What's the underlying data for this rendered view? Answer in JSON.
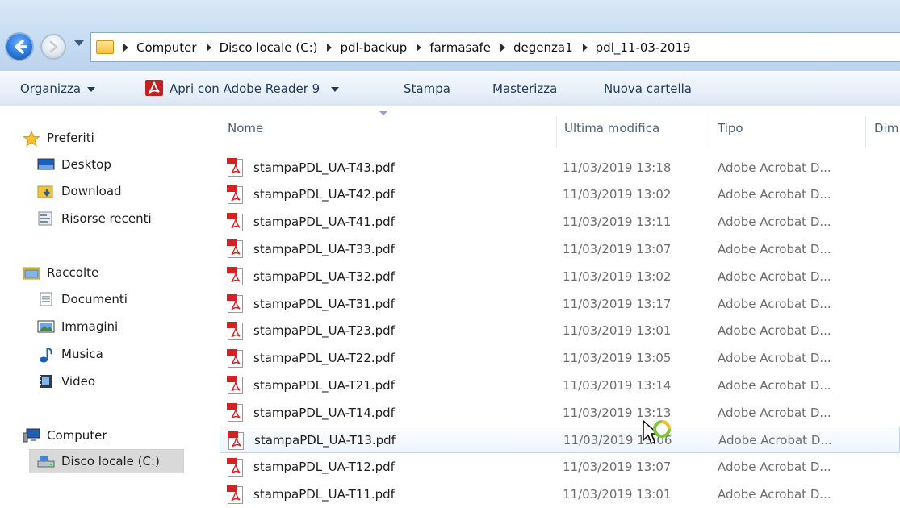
{
  "address": {
    "crumbs": [
      "Computer",
      "Disco locale (C:)",
      "pdl-backup",
      "farmasafe",
      "degenza1",
      "pdl_11-03-2019"
    ]
  },
  "toolbar": {
    "organize": "Organizza",
    "open_with": "Apri con Adobe Reader 9",
    "print": "Stampa",
    "burn": "Masterizza",
    "new_folder": "Nuova cartella"
  },
  "nav": {
    "favorites": "Preferiti",
    "desktop": "Desktop",
    "download": "Download",
    "recent": "Risorse recenti",
    "libraries": "Raccolte",
    "documents": "Documenti",
    "pictures": "Immagini",
    "music": "Musica",
    "video": "Video",
    "computer": "Computer",
    "local_disk": "Disco locale (C:)"
  },
  "columns": {
    "name": "Nome",
    "modified": "Ultima modifica",
    "type": "Tipo",
    "size": "Dim"
  },
  "files": [
    {
      "name": "stampaPDL_UA-T43.pdf",
      "modified": "11/03/2019 13:18",
      "type": "Adobe Acrobat D..."
    },
    {
      "name": "stampaPDL_UA-T42.pdf",
      "modified": "11/03/2019 13:02",
      "type": "Adobe Acrobat D..."
    },
    {
      "name": "stampaPDL_UA-T41.pdf",
      "modified": "11/03/2019 13:11",
      "type": "Adobe Acrobat D..."
    },
    {
      "name": "stampaPDL_UA-T33.pdf",
      "modified": "11/03/2019 13:07",
      "type": "Adobe Acrobat D..."
    },
    {
      "name": "stampaPDL_UA-T32.pdf",
      "modified": "11/03/2019 13:02",
      "type": "Adobe Acrobat D..."
    },
    {
      "name": "stampaPDL_UA-T31.pdf",
      "modified": "11/03/2019 13:17",
      "type": "Adobe Acrobat D..."
    },
    {
      "name": "stampaPDL_UA-T23.pdf",
      "modified": "11/03/2019 13:01",
      "type": "Adobe Acrobat D..."
    },
    {
      "name": "stampaPDL_UA-T22.pdf",
      "modified": "11/03/2019 13:05",
      "type": "Adobe Acrobat D..."
    },
    {
      "name": "stampaPDL_UA-T21.pdf",
      "modified": "11/03/2019 13:14",
      "type": "Adobe Acrobat D..."
    },
    {
      "name": "stampaPDL_UA-T14.pdf",
      "modified": "11/03/2019 13:13",
      "type": "Adobe Acrobat D..."
    },
    {
      "name": "stampaPDL_UA-T13.pdf",
      "modified": "11/03/2019 13:06",
      "type": "Adobe Acrobat D..."
    },
    {
      "name": "stampaPDL_UA-T12.pdf",
      "modified": "11/03/2019 13:07",
      "type": "Adobe Acrobat D..."
    },
    {
      "name": "stampaPDL_UA-T11.pdf",
      "modified": "11/03/2019 13:01",
      "type": "Adobe Acrobat D..."
    }
  ],
  "hovered_file": "stampaPDL_UA-T13.pdf"
}
